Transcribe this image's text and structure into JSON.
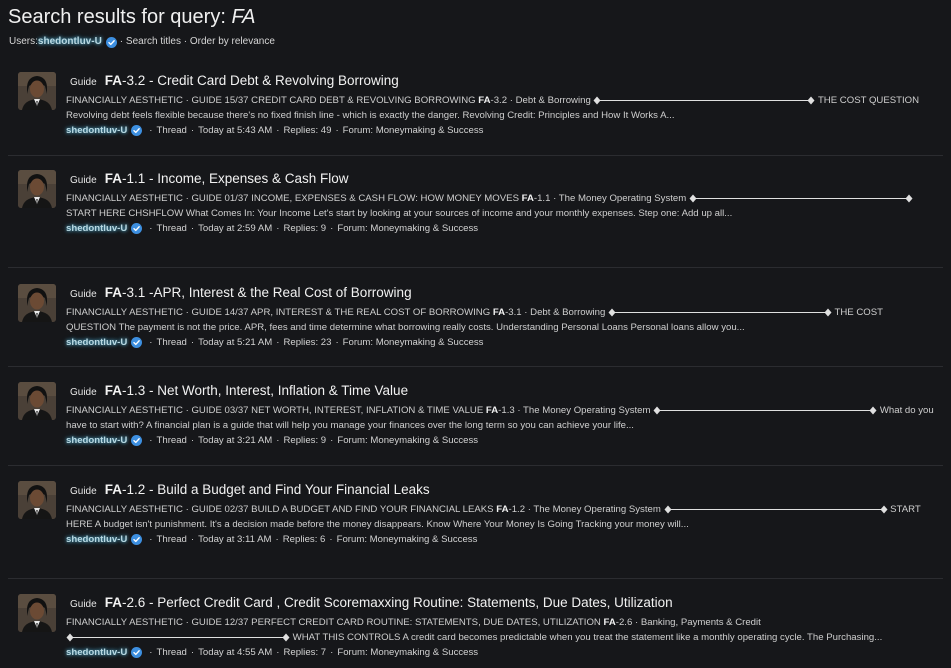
{
  "page": {
    "title_prefix": "Search results for query: ",
    "query": "FA",
    "bg_color": "#16171a"
  },
  "filters": {
    "users_label": "Users: ",
    "username": "shedontluv-U",
    "search_titles": "Search titles",
    "order_by": "Order by relevance",
    "separator": "·"
  },
  "result_type_label": "Guide",
  "results": [
    {
      "title_code": "FA",
      "title_rest": "-3.2 - Credit Card Debt & Revolving Borrowing",
      "snippet": "FINANCIALLY AESTHETIC · GUIDE 15/37 CREDIT CARD DEBT & REVOLVING BORROWING **FA**-3.2 · Debt & Borrowing [SEP] THE COST QUESTION Revolving debt feels flexible because there's no fixed finish line - which is exactly the danger. Revolving Credit: Principles and How It Works A...",
      "author": "shedontluv-U",
      "type": "Thread",
      "time": "Today at 5:43 AM",
      "replies": "Replies: 49",
      "forum": "Forum: Moneymaking & Success"
    },
    {
      "title_code": "FA",
      "title_rest": "-1.1 - Income, Expenses & Cash Flow",
      "snippet": "FINANCIALLY AESTHETIC · GUIDE 01/37 INCOME, EXPENSES & CASH FLOW: HOW MONEY MOVES **FA**-1.1 · The Money Operating System [SEP] START HERE CHSHFLOW What Comes In: Your Income Let's start by looking at your sources of income and your monthly expenses. Step one: Add up all...",
      "author": "shedontluv-U",
      "type": "Thread",
      "time": "Today at 2:59 AM",
      "replies": "Replies: 9",
      "forum": "Forum: Moneymaking & Success"
    },
    {
      "title_code": "FA",
      "title_rest": "-3.1 -APR, Interest & the Real Cost of Borrowing",
      "snippet": "FINANCIALLY AESTHETIC · GUIDE 14/37 APR, INTEREST & THE REAL COST OF BORROWING **FA**-3.1 · Debt & Borrowing [SEP] THE COST QUESTION The payment is not the price. APR, fees and time determine what borrowing really costs. Understanding Personal Loans Personal loans allow you...",
      "author": "shedontluv-U",
      "type": "Thread",
      "time": "Today at 5:21 AM",
      "replies": "Replies: 23",
      "forum": "Forum: Moneymaking & Success"
    },
    {
      "title_code": "FA",
      "title_rest": "-1.3 - Net Worth, Interest, Inflation & Time Value",
      "snippet": "FINANCIALLY AESTHETIC · GUIDE 03/37 NET WORTH, INTEREST, INFLATION & TIME VALUE **FA**-1.3 · The Money Operating System [SEP] What do you have to start with? A financial plan is a guide that will help you manage your finances over the long term so you can achieve your life...",
      "author": "shedontluv-U",
      "type": "Thread",
      "time": "Today at 3:21 AM",
      "replies": "Replies: 9",
      "forum": "Forum: Moneymaking & Success"
    },
    {
      "title_code": "FA",
      "title_rest": "-1.2 - Build a Budget and Find Your Financial Leaks",
      "snippet": "FINANCIALLY AESTHETIC · GUIDE 02/37 BUILD A BUDGET AND FIND YOUR FINANCIAL LEAKS **FA**-1.2 · The Money Operating System [SEP] START HERE A budget isn't punishment. It's a decision made before the money disappears. Know Where Your Money Is Going Tracking your money will...",
      "author": "shedontluv-U",
      "type": "Thread",
      "time": "Today at 3:11 AM",
      "replies": "Replies: 6",
      "forum": "Forum: Moneymaking & Success"
    },
    {
      "title_code": "FA",
      "title_rest": "-2.6 - Perfect Credit Card , Credit Scoremaxxing Routine: Statements, Due Dates, Utilization",
      "snippet": "FINANCIALLY AESTHETIC · GUIDE 12/37 PERFECT CREDIT CARD ROUTINE: STATEMENTS, DUE DATES, UTILIZATION **FA**-2.6 · Banking, Payments & Credit [SEP] WHAT THIS CONTROLS A credit card becomes predictable when you treat the statement like a monthly operating cycle. The Purchasing...",
      "author": "shedontluv-U",
      "type": "Thread",
      "time": "Today at 4:55 AM",
      "replies": "Replies: 7",
      "forum": "Forum: Moneymaking & Success"
    }
  ],
  "colors": {
    "username_glow": "#5cc4eb",
    "verified_badge": "#3d8fe0",
    "divider": "#2b2c30"
  }
}
